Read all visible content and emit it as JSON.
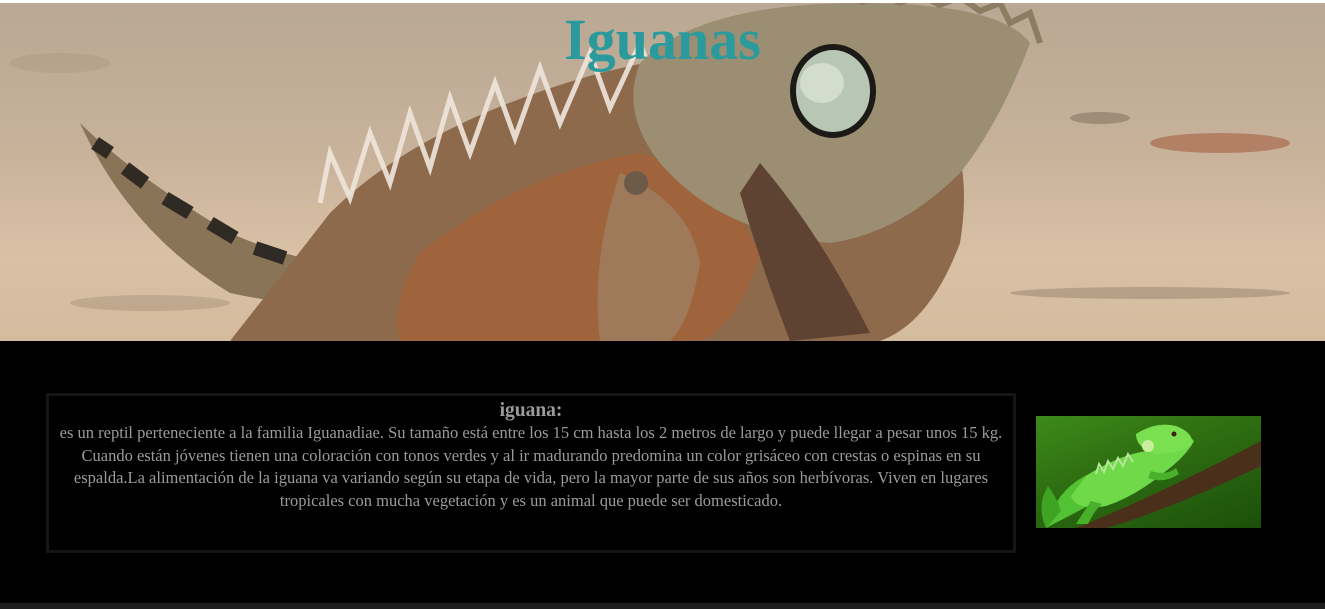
{
  "header": {
    "title": "Iguanas"
  },
  "article": {
    "heading": "iguana:",
    "body": "es un reptil perteneciente a la familia Iguanadiae. Su tamaño está entre los 15 cm hasta los 2 metros de largo y puede llegar a pesar unos 15 kg. Cuando están jóvenes tienen una coloración con tonos verdes y al ir madurando predomina un color grisáceo con crestas o espinas en su espalda.La alimentación de la iguana va variando según su etapa de vida, pero la mayor parte de sus años son herbívoras. Viven en lugares tropicales con mucha vegetación y es un animal que puede ser domesticado."
  },
  "colors": {
    "title": "#2b9a9d",
    "text": "#9b9b9b",
    "background": "#000000"
  }
}
